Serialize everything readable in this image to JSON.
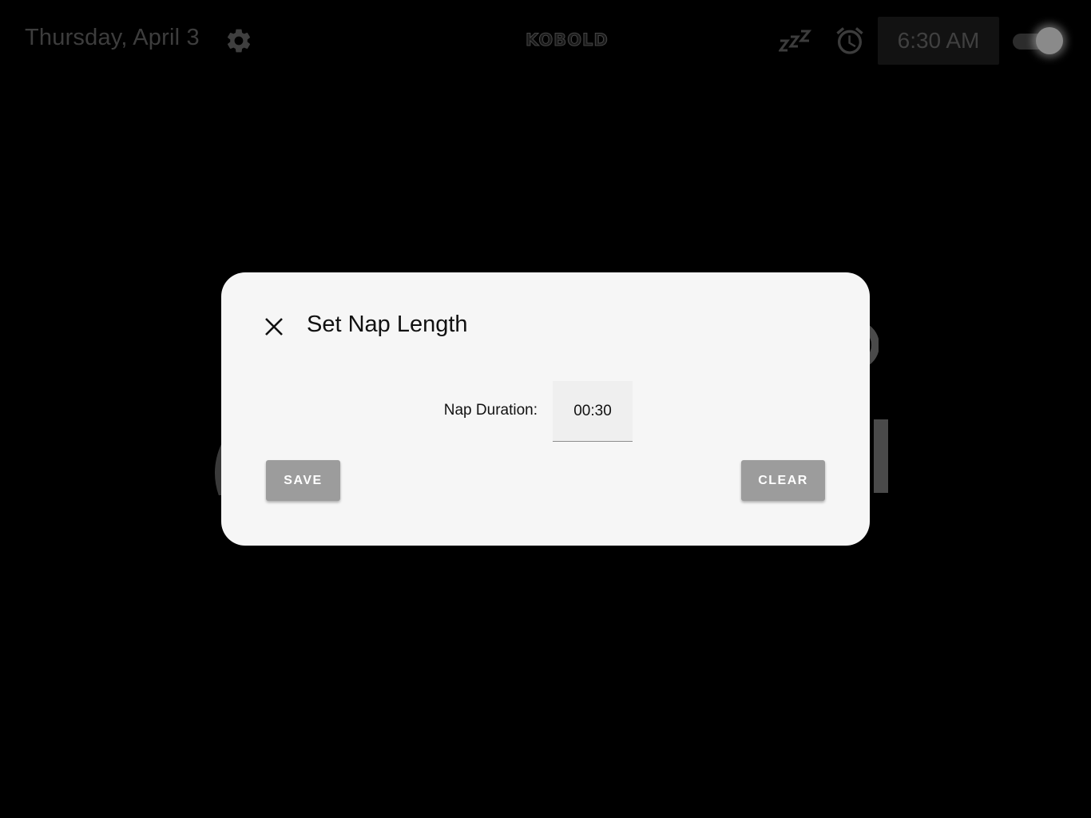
{
  "topbar": {
    "date": "Thursday, April 3",
    "logo": "KOBOLD",
    "alarm_time": "6:30 AM",
    "alarm_enabled": true,
    "icons": {
      "settings": "gear-icon",
      "snooze": "snooze-zzz-icon",
      "alarm": "alarm-clock-icon"
    }
  },
  "dialog": {
    "title": "Set Nap Length",
    "close_icon": "close-icon",
    "duration_label": "Nap Duration:",
    "duration_value": "00:30",
    "save_label": "SAVE",
    "clear_label": "CLEAR"
  },
  "colors": {
    "dialog_background": "#f6f6f6",
    "button_background": "#9c9c9c",
    "screen_background": "#000000"
  }
}
